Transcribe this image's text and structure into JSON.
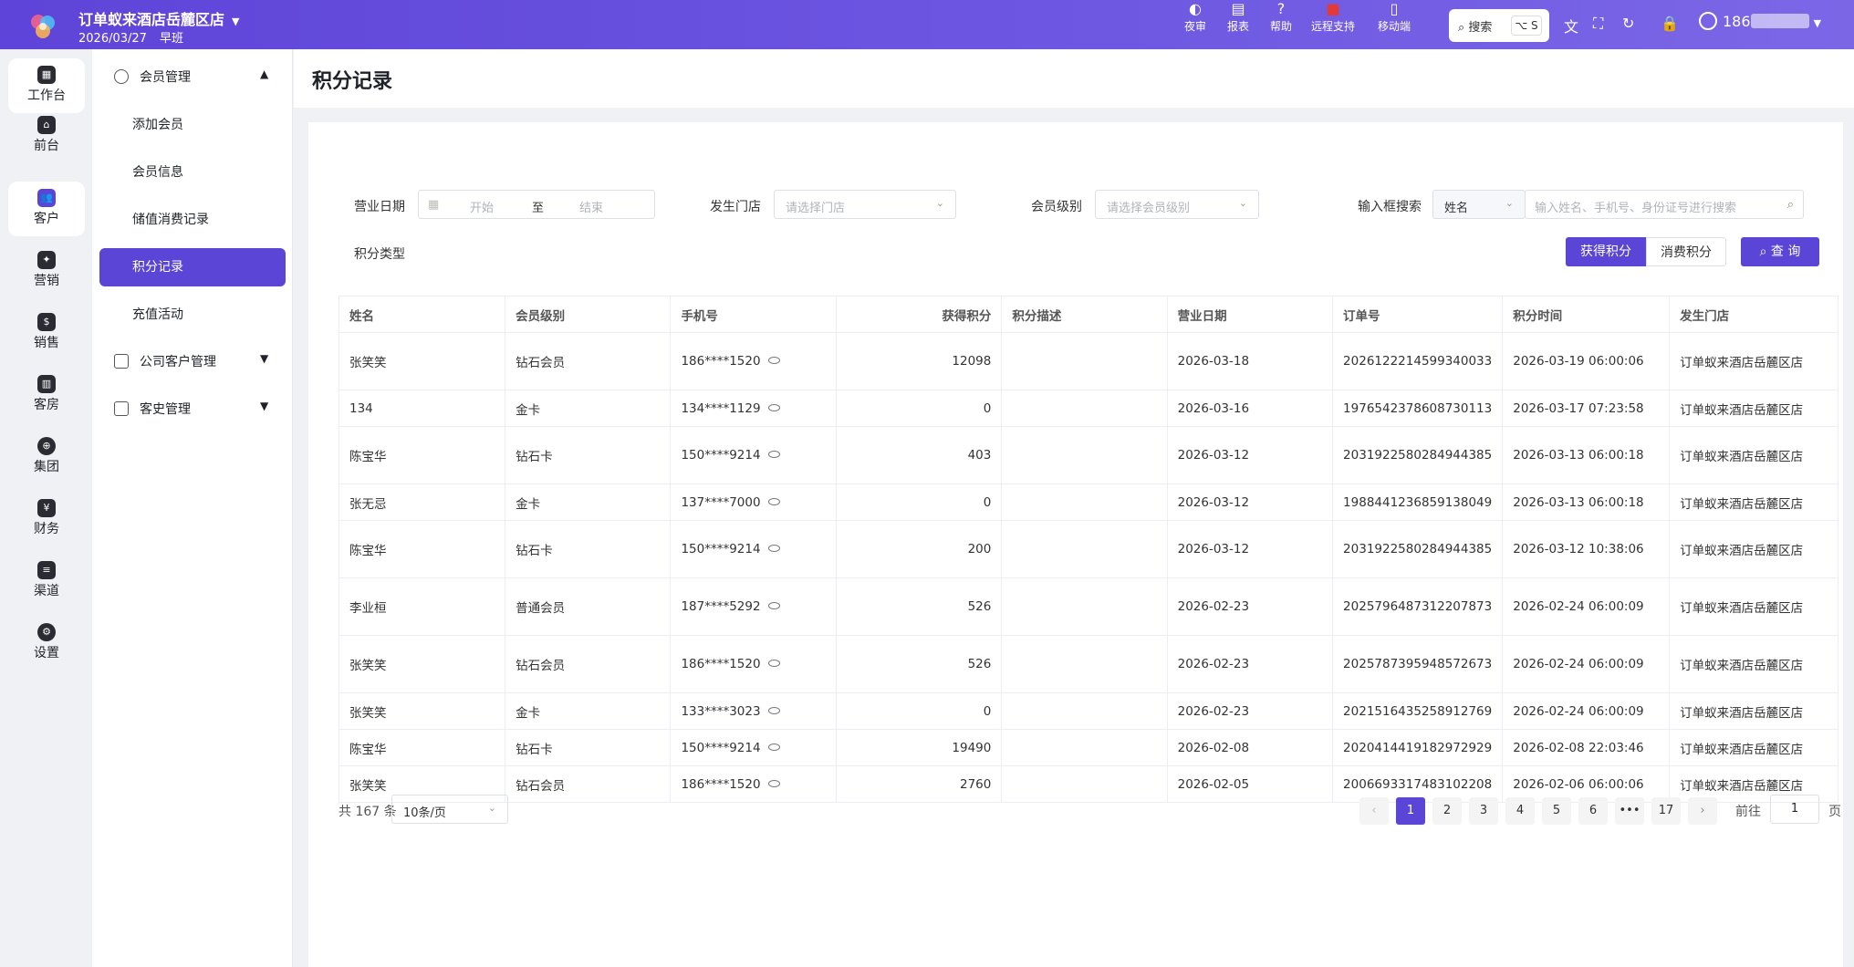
{
  "app": {
    "hotel_name": "订单蚁来酒店岳麓区店",
    "date": "2026/03/27",
    "shift": "早班",
    "user_display": "186"
  },
  "toolbar": {
    "night_audit": "夜审",
    "report": "报表",
    "help": "帮助",
    "remote_support": "远程支持",
    "mobile": "移动端",
    "search_label": "搜索",
    "search_shortcut": "⌥ S"
  },
  "rail": [
    {
      "label": "工作台",
      "icon": "grid-icon"
    },
    {
      "label": "前台",
      "icon": "home-icon"
    },
    {
      "label": "客户",
      "icon": "users-icon"
    },
    {
      "label": "营销",
      "icon": "marketing-icon"
    },
    {
      "label": "销售",
      "icon": "sales-icon"
    },
    {
      "label": "客房",
      "icon": "room-icon"
    },
    {
      "label": "集团",
      "icon": "globe-icon"
    },
    {
      "label": "财务",
      "icon": "money-bag-icon"
    },
    {
      "label": "渠道",
      "icon": "sliders-icon"
    },
    {
      "label": "设置",
      "icon": "settings-icon"
    }
  ],
  "subnav": {
    "member_mgmt": "会员管理",
    "items": [
      "添加会员",
      "会员信息",
      "储值消费记录",
      "积分记录",
      "充值活动"
    ],
    "company_client_mgmt": "公司客户管理",
    "guest_history_mgmt": "客史管理"
  },
  "page": {
    "title": "积分记录"
  },
  "filters": {
    "business_date_label": "营业日期",
    "start_placeholder": "开始",
    "to": "至",
    "end_placeholder": "结束",
    "store_label": "发生门店",
    "store_placeholder": "请选择门店",
    "level_label": "会员级别",
    "level_placeholder": "请选择会员级别",
    "search_by_label": "输入框搜索",
    "search_by_value": "姓名",
    "keyword_placeholder": "输入姓名、手机号、身份证号进行搜索",
    "points_type_label": "积分类型",
    "earn_points": "获得积分",
    "spend_points": "消费积分",
    "query": "查 询"
  },
  "table": {
    "headers": [
      "姓名",
      "会员级别",
      "手机号",
      "获得积分",
      "积分描述",
      "营业日期",
      "订单号",
      "积分时间",
      "发生门店"
    ],
    "rows": [
      {
        "name": "张笑笑",
        "level": "钻石会员",
        "phone": "186****1520",
        "points": "12098",
        "desc": "",
        "date": "2026-03-18",
        "order": "2026122214599340033",
        "time": "2026-03-19 06:00:06",
        "store": "订单蚁来酒店岳麓区店"
      },
      {
        "name": "134",
        "level": "金卡",
        "phone": "134****1129",
        "points": "0",
        "desc": "",
        "date": "2026-03-16",
        "order": "1976542378608730113",
        "time": "2026-03-17 07:23:58",
        "store": "订单蚁来酒店岳麓区店"
      },
      {
        "name": "陈宝华",
        "level": "钻石卡",
        "phone": "150****9214",
        "points": "403",
        "desc": "",
        "date": "2026-03-12",
        "order": "2031922580284944385",
        "time": "2026-03-13 06:00:18",
        "store": "订单蚁来酒店岳麓区店"
      },
      {
        "name": "张无忌",
        "level": "金卡",
        "phone": "137****7000",
        "points": "0",
        "desc": "",
        "date": "2026-03-12",
        "order": "1988441236859138049",
        "time": "2026-03-13 06:00:18",
        "store": "订单蚁来酒店岳麓区店"
      },
      {
        "name": "陈宝华",
        "level": "钻石卡",
        "phone": "150****9214",
        "points": "200",
        "desc": "",
        "date": "2026-03-12",
        "order": "2031922580284944385",
        "time": "2026-03-12 10:38:06",
        "store": "订单蚁来酒店岳麓区店"
      },
      {
        "name": "李业桓",
        "level": "普通会员",
        "phone": "187****5292",
        "points": "526",
        "desc": "",
        "date": "2026-02-23",
        "order": "2025796487312207873",
        "time": "2026-02-24 06:00:09",
        "store": "订单蚁来酒店岳麓区店"
      },
      {
        "name": "张笑笑",
        "level": "钻石会员",
        "phone": "186****1520",
        "points": "526",
        "desc": "",
        "date": "2026-02-23",
        "order": "2025787395948572673",
        "time": "2026-02-24 06:00:09",
        "store": "订单蚁来酒店岳麓区店"
      },
      {
        "name": "张笑笑",
        "level": "金卡",
        "phone": "133****3023",
        "points": "0",
        "desc": "",
        "date": "2026-02-23",
        "order": "2021516435258912769",
        "time": "2026-02-24 06:00:09",
        "store": "订单蚁来酒店岳麓区店"
      },
      {
        "name": "陈宝华",
        "level": "钻石卡",
        "phone": "150****9214",
        "points": "19490",
        "desc": "",
        "date": "2026-02-08",
        "order": "2020414419182972929",
        "time": "2026-02-08 22:03:46",
        "store": "订单蚁来酒店岳麓区店"
      },
      {
        "name": "张笑笑",
        "level": "钻石会员",
        "phone": "186****1520",
        "points": "2760",
        "desc": "",
        "date": "2026-02-05",
        "order": "2006693317483102208",
        "time": "2026-02-06 06:00:06",
        "store": "订单蚁来酒店岳麓区店"
      }
    ]
  },
  "pagination": {
    "total": "共 167 条",
    "page_size": "10条/页",
    "pages": [
      "1",
      "2",
      "3",
      "4",
      "5",
      "6",
      "•••",
      "17"
    ],
    "current": "1",
    "goto_label": "前往",
    "goto_value": "1",
    "page_suffix": "页",
    "prev": "‹",
    "next": "›"
  }
}
